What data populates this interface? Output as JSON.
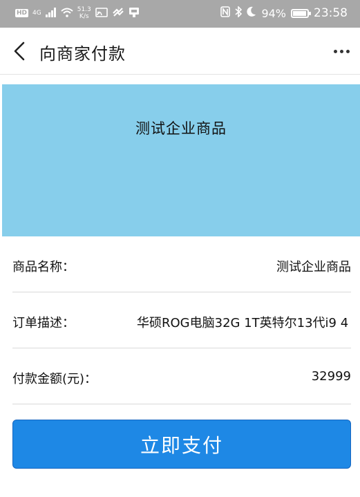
{
  "status_bar": {
    "hd": "HD",
    "network": "4G",
    "speed_value": "51.3",
    "speed_unit": "K/s",
    "battery_percent": "94%",
    "battery_level": 0.94,
    "time": "23:58",
    "icons": [
      "signal-icon",
      "wifi-icon",
      "cast-icon",
      "link-icon",
      "sim-icon",
      "nfc-icon",
      "bluetooth-icon",
      "moon-icon",
      "battery-icon"
    ]
  },
  "header": {
    "title": "向商家付款",
    "back_icon": "chevron-left-icon",
    "more_icon": "more-dots-icon"
  },
  "banner": {
    "title": "测试企业商品",
    "bg_color": "#87ceeb"
  },
  "rows": [
    {
      "label": "商品名称：",
      "value": "测试企业商品"
    },
    {
      "label": "订单描述：",
      "value": "华硕ROG电脑32G 1T英特尔13代i9 4"
    },
    {
      "label": "付款金额(元)：",
      "value": "32999"
    }
  ],
  "pay_button": {
    "label": "立即支付",
    "color": "#1e88e5"
  }
}
